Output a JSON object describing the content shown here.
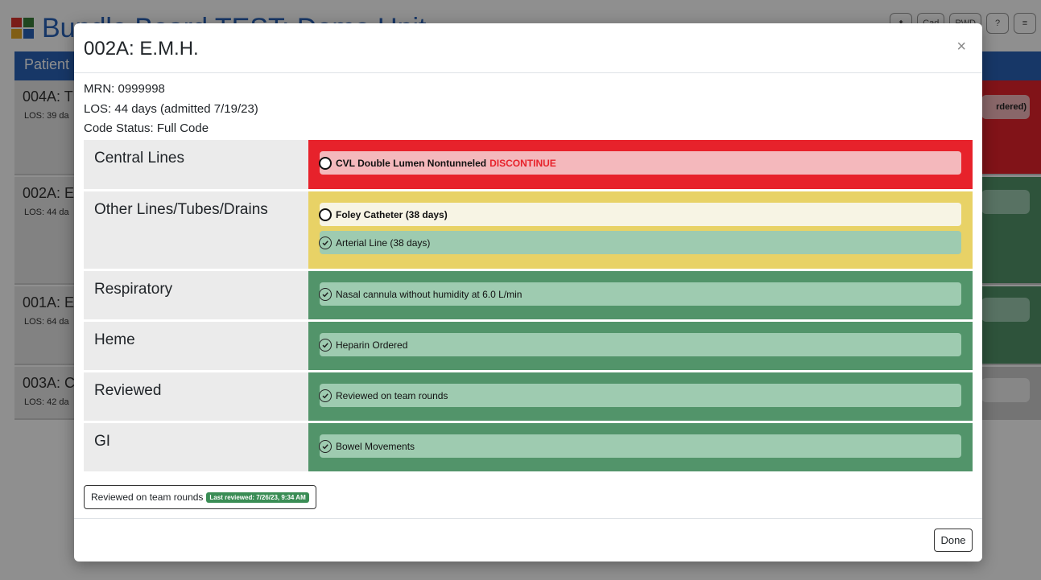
{
  "background": {
    "app_title": "Bundle Board TEST: Demo Unit",
    "tab_label": "Patient",
    "toolbar": [
      "⬆",
      "Cad",
      "PWD",
      "?",
      "≡"
    ],
    "patients": [
      {
        "id": "004A: T",
        "los": "LOS: 39 da",
        "status_text": "rdered)"
      },
      {
        "id": "002A: E",
        "los": "LOS: 44 da"
      },
      {
        "id": "001A: E",
        "los": "LOS: 64 da"
      },
      {
        "id": "003A: C",
        "los": "LOS: 42 da"
      }
    ]
  },
  "modal": {
    "title": "002A: E.M.H.",
    "close_label": "×",
    "mrn": "MRN: 0999998",
    "los": "LOS: 44 days (admitted 7/19/23)",
    "code_status": "Code Status: Full Code",
    "categories": [
      {
        "label": "Central Lines",
        "status": "red",
        "items": [
          {
            "text": "CVL Double Lumen Nontunneled",
            "action": "DISCONTINUE",
            "checked": false
          }
        ]
      },
      {
        "label": "Other Lines/Tubes/Drains",
        "status": "yellow",
        "items": [
          {
            "text": "Foley Catheter (38 days)",
            "checked": false
          },
          {
            "text": "Arterial Line (38 days)",
            "checked": true
          }
        ]
      },
      {
        "label": "Respiratory",
        "status": "green",
        "items": [
          {
            "text": "Nasal cannula without humidity at 6.0 L/min",
            "checked": true
          }
        ]
      },
      {
        "label": "Heme",
        "status": "green",
        "items": [
          {
            "text": "Heparin Ordered",
            "checked": true
          }
        ]
      },
      {
        "label": "Reviewed",
        "status": "green",
        "items": [
          {
            "text": "Reviewed on team rounds",
            "checked": true
          }
        ]
      },
      {
        "label": "GI",
        "status": "green",
        "items": [
          {
            "text": "Bowel Movements",
            "checked": true
          }
        ]
      }
    ],
    "review_button_label": "Reviewed on team rounds",
    "last_reviewed_badge": "Last reviewed: 7/26/23, 9:34 AM",
    "done_label": "Done"
  },
  "colors": {
    "red": "#e7222b",
    "yellow": "#e8d266",
    "green": "#52946a",
    "brand_blue": "#2a63b8"
  }
}
